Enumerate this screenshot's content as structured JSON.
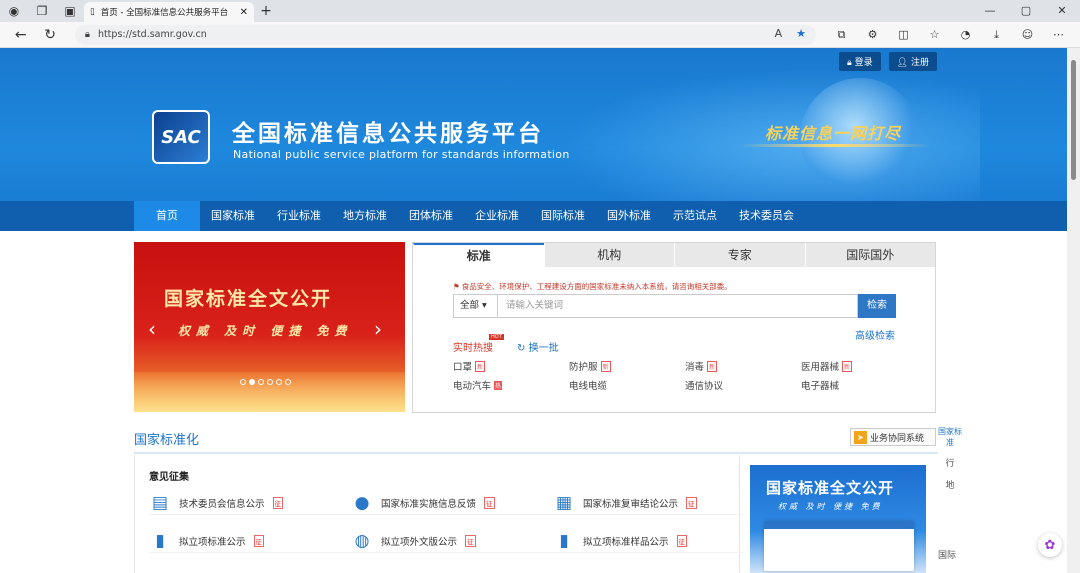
{
  "browser": {
    "tab_title": "首页 - 全国标准信息公共服务平台",
    "tab_close": "✕",
    "new_tab": "+",
    "url": "https://std.samr.gov.cn",
    "back": "←",
    "refresh": "↻",
    "win_min": "—",
    "win_max": "▢",
    "win_close": "✕"
  },
  "header": {
    "login": "登录",
    "register": "注册",
    "logo_text": "SAC",
    "site_title": "全国标准信息公共服务平台",
    "site_subtitle": "National public service platform  for standards information",
    "slogan": "标准信息一网打尽"
  },
  "nav": [
    "首页",
    "国家标准",
    "行业标准",
    "地方标准",
    "团体标准",
    "企业标准",
    "国际标准",
    "国外标准",
    "示范试点",
    "技术委员会"
  ],
  "banner": {
    "title": "国家标准全文公开",
    "slogan": "权威 及时 便捷 免费",
    "prev": "‹",
    "next": "›"
  },
  "search": {
    "tabs": [
      "标准",
      "机构",
      "专家",
      "国际国外"
    ],
    "notice": "食品安全、环境保护、工程建设方面的国家标准未纳入本系统，请咨询相关部委。",
    "scope": "全部",
    "placeholder": "请输入关键词",
    "button": "检索",
    "advanced": "高级检索",
    "hot_label": "实时热搜",
    "hot_badge": "HOT",
    "refresh": "换一批",
    "hot_items": [
      {
        "label": "口罩",
        "tag": "新",
        "tag_type": "new"
      },
      {
        "label": "防护服",
        "tag": "新",
        "tag_type": "new"
      },
      {
        "label": "消毒",
        "tag": "新",
        "tag_type": "new"
      },
      {
        "label": "医用器械",
        "tag": "新",
        "tag_type": "new"
      },
      {
        "label": "电动汽车",
        "tag": "热",
        "tag_type": "hot"
      },
      {
        "label": "电线电缆",
        "tag": "",
        "tag_type": ""
      },
      {
        "label": "通信协议",
        "tag": "",
        "tag_type": ""
      },
      {
        "label": "电子器械",
        "tag": "",
        "tag_type": ""
      }
    ]
  },
  "section": {
    "title": "国家标准化",
    "coop_button": "业务协同系统",
    "panel_heading": "意见征集",
    "items": [
      {
        "label": "技术委员会信息公示",
        "tag": "征",
        "icon": "id-card-icon",
        "glyph": "▤"
      },
      {
        "label": "国家标准实施信息反馈",
        "tag": "征",
        "icon": "chat-icon",
        "glyph": "●"
      },
      {
        "label": "国家标准复审结论公示",
        "tag": "征",
        "icon": "document-icon",
        "glyph": "▦"
      },
      {
        "label": "拟立项标准公示",
        "tag": "征",
        "icon": "book-icon",
        "glyph": "▮"
      },
      {
        "label": "拟立项外文版公示",
        "tag": "征",
        "icon": "globe-icon",
        "glyph": "◍"
      },
      {
        "label": "拟立项标准样品公示",
        "tag": "征",
        "icon": "book-icon",
        "glyph": "▮"
      }
    ],
    "ad_title": "国家标准全文公开",
    "ad_slogan": "权威 及时 便捷 免费"
  },
  "side": {
    "link": "国家标准",
    "tabs": [
      "行",
      "地"
    ],
    "bottom": "国际"
  },
  "colors": {
    "primary": "#1a73c9",
    "nav_bg": "#0f5fae",
    "accent_red": "#d73527"
  }
}
